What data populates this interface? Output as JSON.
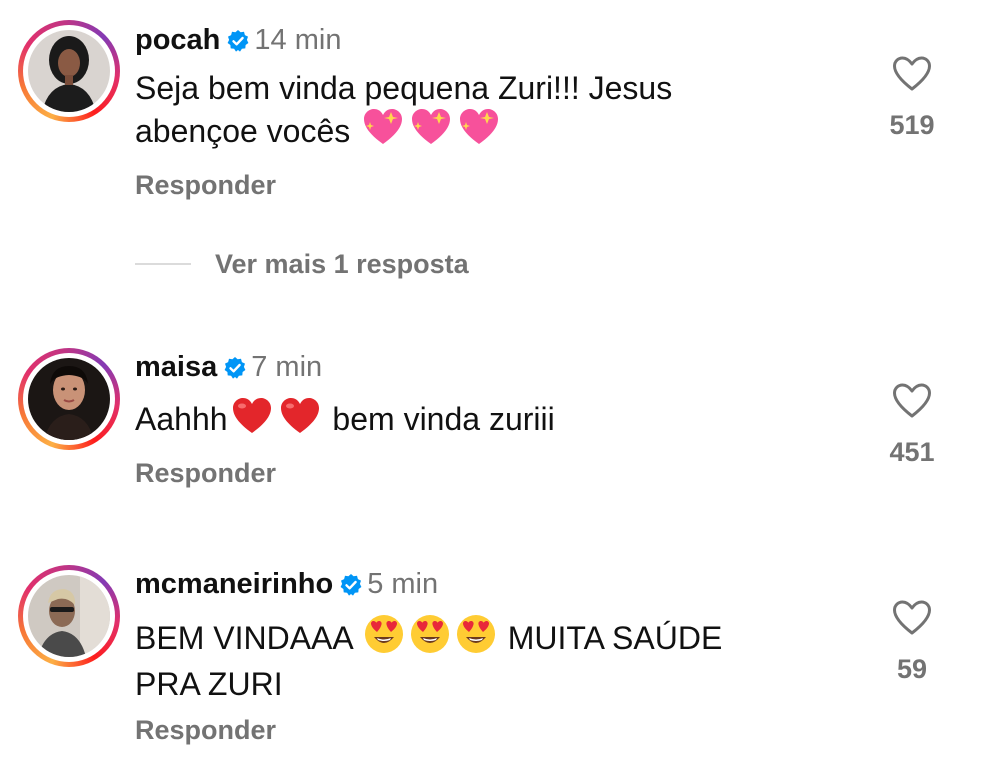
{
  "comments": [
    {
      "username": "pocah",
      "time": "14 min",
      "text_line1": "Seja bem vinda pequena Zuri!!! Jesus",
      "text_line2": "abençoe vocês",
      "emoji_name": "sparkling-heart-icon",
      "reply": "Responder",
      "likes": "519"
    },
    {
      "username": "maisa",
      "time": "7 min",
      "text_before": "Aahhh",
      "text_after": " bem vinda zuriii",
      "emoji_name": "red-heart-icon",
      "reply": "Responder",
      "likes": "451"
    },
    {
      "username": "mcmaneirinho",
      "time": "5 min",
      "text_before": "BEM VINDAAA",
      "text_after": " MUITA SAÚDE",
      "text_line2": "PRA ZURI",
      "emoji_name": "heart-eyes-icon",
      "reply": "Responder",
      "likes": "59"
    }
  ],
  "view_more": "Ver mais 1 resposta",
  "colors": {
    "verified": "#0095f6",
    "muted": "#737373",
    "text": "#111111"
  }
}
